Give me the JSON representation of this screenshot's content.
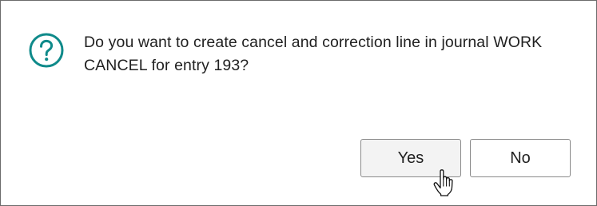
{
  "dialog": {
    "icon": "question-circle-icon",
    "accent_color": "#0f8a8a",
    "message_line1": "Do you want to create cancel and correction line in journal WORK",
    "message_line2": "CANCEL for entry 193?",
    "buttons": {
      "yes_label": "Yes",
      "no_label": "No"
    }
  },
  "cursor": {
    "icon": "hand-pointer-icon"
  }
}
